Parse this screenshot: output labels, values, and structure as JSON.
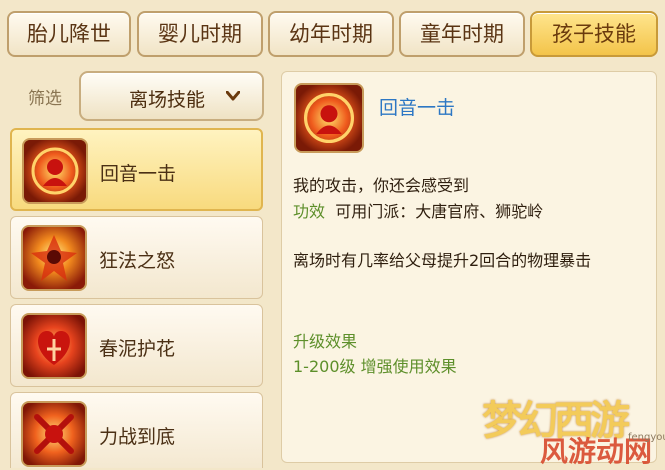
{
  "tabs": [
    {
      "label": "胎儿降世",
      "active": false
    },
    {
      "label": "婴儿时期",
      "active": false
    },
    {
      "label": "幼年时期",
      "active": false
    },
    {
      "label": "童年时期",
      "active": false
    },
    {
      "label": "孩子技能",
      "active": true
    }
  ],
  "filter": {
    "label": "筛选",
    "selected": "离场技能"
  },
  "skills": [
    {
      "name": "回音一击",
      "selected": true
    },
    {
      "name": "狂法之怒",
      "selected": false
    },
    {
      "name": "春泥护花",
      "selected": false
    },
    {
      "name": "力战到底",
      "selected": false
    }
  ],
  "detail": {
    "title": "回音一击",
    "quote": "我的攻击，你还会感受到",
    "effect_label": "功效",
    "effect_text": "可用门派：大唐官府、狮驼岭",
    "description": "离场时有几率给父母提升2回合的物理暴击",
    "upgrade_label": "升级效果",
    "upgrade_range": "1-200级",
    "upgrade_text": "增强使用效果"
  },
  "watermark": {
    "game": "梦幻西游",
    "site": "风游动网",
    "domain": "fengyou.NET"
  },
  "colors": {
    "active_tab": "#f3c44a",
    "title_blue": "#2d77c4",
    "green": "#5d8f2a"
  }
}
